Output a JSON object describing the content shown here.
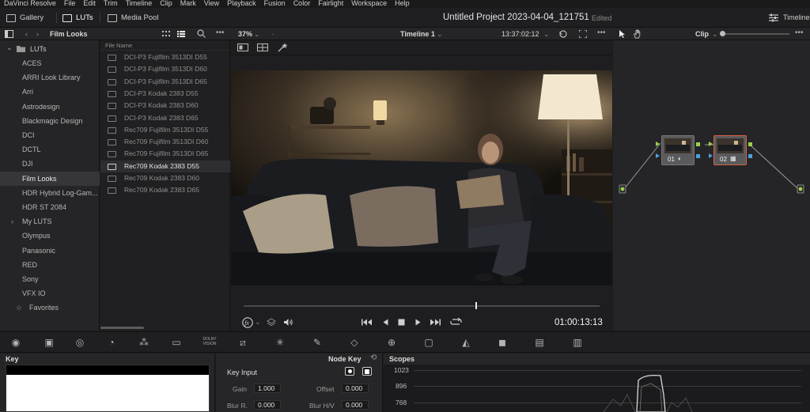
{
  "menu": [
    "DaVinci Resolve",
    "File",
    "Edit",
    "Trim",
    "Timeline",
    "Clip",
    "Mark",
    "View",
    "Playback",
    "Fusion",
    "Color",
    "Fairlight",
    "Workspace",
    "Help"
  ],
  "toolbar": {
    "gallery": "Gallery",
    "luts": "LUTs",
    "media_pool": "Media Pool",
    "project_title": "Untitled Project 2023-04-04_121751",
    "project_status": "Edited",
    "timeline": "Timeline"
  },
  "lut_browser": {
    "title": "Film Looks",
    "root": "LUTs",
    "folders": [
      "ACES",
      "ARRI Look Library",
      "Arri",
      "Astrodesign",
      "Blackmagic Design",
      "DCI",
      "DCTL",
      "DJI",
      "Film Looks",
      "HDR Hybrid Log-Gam...",
      "HDR ST 2084",
      "My LUTS",
      "Olympus",
      "Panasonic",
      "RED",
      "Sony",
      "VFX IO",
      "Favorites"
    ],
    "selected_folder": "Film Looks"
  },
  "file_list": {
    "column_header": "File Name",
    "files": [
      "DCI-P3 Fujifilm 3513DI D55",
      "DCI-P3 Fujifilm 3513DI D60",
      "DCI-P3 Fujifilm 3513DI D65",
      "DCI-P3 Kodak 2383 D55",
      "DCI-P3 Kodak 2383 D60",
      "DCI-P3 Kodak 2383 D65",
      "Rec709 Fujifilm 3513DI D55",
      "Rec709 Fujifilm 3513DI D60",
      "Rec709 Fujifilm 3513DI D65",
      "Rec709 Kodak 2383 D55",
      "Rec709 Kodak 2383 D60",
      "Rec709 Kodak 2383 D65"
    ],
    "selected": "Rec709 Kodak 2383 D55"
  },
  "viewer": {
    "zoom": "37%",
    "timeline_name": "Timeline 1",
    "source_timecode": "13:37:02:12",
    "record_timecode": "01:00:13:13",
    "playhead_fraction": 0.65
  },
  "node_editor": {
    "mode": "Clip",
    "nodes": [
      {
        "label": "01"
      },
      {
        "label": "02"
      }
    ]
  },
  "palette_icons": [
    "camera-raw-icon",
    "color-match-icon",
    "color-wheels-icon",
    "hdr-icon",
    "rgb-mixer-icon",
    "motion-effects-icon",
    "dolby-vision-icon",
    "curves-icon",
    "color-warper-icon",
    "qualifier-icon",
    "window-icon",
    "tracker-icon",
    "magic-mask-icon",
    "blur-icon",
    "key-icon",
    "sizing-icon",
    "3d-icon"
  ],
  "palette": {
    "dolby_top": "DOLBY",
    "dolby_bottom": "VISION"
  },
  "key_panel": {
    "title": "Key",
    "node_key": "Node Key"
  },
  "key_input": {
    "title": "Key Input",
    "gain_label": "Gain",
    "gain_value": "1.000",
    "offset_label": "Offset",
    "offset_value": "0.000",
    "blur_r_label": "Blur R.",
    "blur_r_value": "0.000",
    "blur_hv_label": "Blur H/V",
    "blur_hv_value": "0.000"
  },
  "scopes": {
    "title": "Scopes",
    "ticks": [
      "1023",
      "896",
      "768"
    ]
  },
  "colors": {
    "accent_green": "#9bd14a",
    "accent_blue": "#4aa3df",
    "selected_node_outline": "#d9613f"
  }
}
